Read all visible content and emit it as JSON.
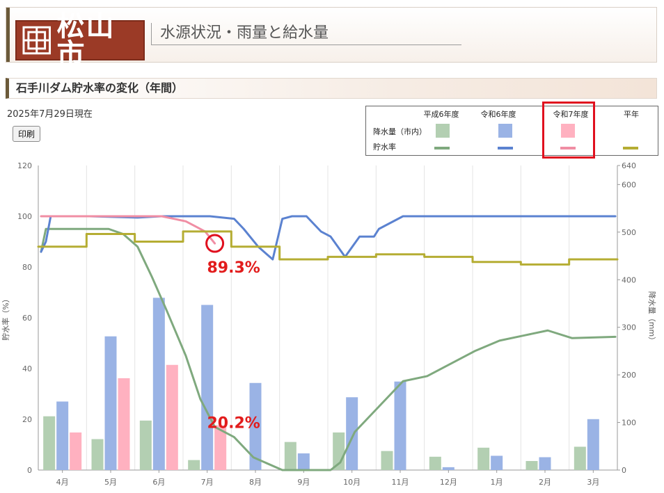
{
  "header": {
    "logo_text": "松山市",
    "title": "水源状況・雨量と給水量"
  },
  "section": {
    "title": "石手川ダム貯水率の変化（年間）",
    "as_of": "2025年7月29日現在",
    "print_label": "印刷"
  },
  "legend": {
    "headers": [
      "平成6年度",
      "令和6年度",
      "令和7年度",
      "平年"
    ],
    "row_rain": "降水量（市内）",
    "row_storage": "貯水率"
  },
  "colors": {
    "h6": "#7fa97e",
    "r6": "#5b82d0",
    "r7": "#f08ea4",
    "normal": "#b5ad33",
    "h6_bar": "#b3cfb2",
    "r6_bar": "#9ab3e5",
    "r7_bar": "#ffb1c0",
    "highlight": "#e0101e"
  },
  "chart_data": {
    "type": "bar+line",
    "categories": [
      "4月",
      "5月",
      "6月",
      "7月",
      "8月",
      "9月",
      "10月",
      "11月",
      "12月",
      "1月",
      "2月",
      "3月"
    ],
    "ylabel_left": "貯水率（%）",
    "ylabel_right": "降水量（mm）",
    "ylim_left": [
      0,
      120
    ],
    "ylim_right": [
      0,
      640
    ],
    "yticks_left": [
      0,
      20,
      40,
      60,
      80,
      100,
      120
    ],
    "yticks_right": [
      0,
      100,
      200,
      300,
      400,
      500,
      600,
      640
    ],
    "grid": "vertical",
    "rain_series": [
      {
        "name": "平成6年度",
        "values": [
          113,
          65,
          104,
          21,
          0,
          59,
          79,
          40,
          28,
          47,
          19,
          49
        ]
      },
      {
        "name": "令和6年度",
        "values": [
          144,
          281,
          362,
          347,
          183,
          35,
          153,
          186,
          6,
          30,
          27,
          107
        ]
      },
      {
        "name": "令和7年度",
        "values": [
          79,
          193,
          221,
          94
        ]
      }
    ],
    "storage_series": [
      {
        "name": "平成6年度",
        "x": [
          0,
          0.1,
          0.5,
          1.0,
          1.4,
          1.7,
          2.0,
          2.3,
          2.6,
          3.0,
          3.3,
          3.6,
          4.0,
          4.4,
          5.0,
          6.0,
          6.2,
          6.5,
          7.0,
          7.5,
          8.0,
          8.5,
          9.0,
          9.5,
          10.0,
          10.5,
          11.0,
          11.9
        ],
        "y": [
          86,
          95,
          95,
          95,
          95,
          93,
          88,
          76,
          63,
          45,
          28,
          17,
          13,
          5,
          0,
          0,
          3,
          15,
          25,
          35,
          37,
          42,
          47,
          51,
          53,
          55,
          52,
          52.5
        ]
      },
      {
        "name": "令和6年度",
        "x": [
          0,
          0.1,
          0.2,
          0.5,
          1.0,
          2.0,
          2.5,
          3.0,
          3.5,
          4.0,
          4.2,
          4.5,
          4.8,
          5.0,
          5.2,
          5.5,
          5.8,
          6.0,
          6.3,
          6.6,
          6.9,
          7.0,
          7.5,
          8.0,
          9.0,
          10.0,
          11.0,
          11.9
        ],
        "y": [
          86,
          90,
          100,
          100,
          100,
          99.5,
          100,
          100,
          100,
          99,
          95,
          88,
          83,
          99,
          100,
          100,
          94,
          92,
          84,
          92,
          92,
          95,
          100,
          100,
          100,
          100,
          100,
          100
        ]
      },
      {
        "name": "令和7年度",
        "x": [
          0,
          0.5,
          1.0,
          1.5,
          2.0,
          2.5,
          3.0,
          3.2,
          3.4,
          3.6
        ],
        "y": [
          100,
          100,
          100,
          100,
          100,
          100,
          98,
          96,
          94,
          89.3
        ]
      },
      {
        "name": "平年",
        "x": [
          0,
          1,
          2,
          3,
          4,
          5,
          6,
          7,
          8,
          9,
          10,
          11,
          11.9
        ],
        "y": [
          88,
          93,
          90,
          94,
          88,
          83,
          84,
          85,
          84,
          82,
          81,
          83,
          83
        ]
      }
    ],
    "annotations": [
      {
        "text": "89.3%",
        "series": "令和7年度",
        "month_index": 3,
        "value": 89.3
      },
      {
        "text": "20.2%",
        "series": "平成6年度",
        "month_index": 3,
        "value": 20.2
      }
    ]
  }
}
